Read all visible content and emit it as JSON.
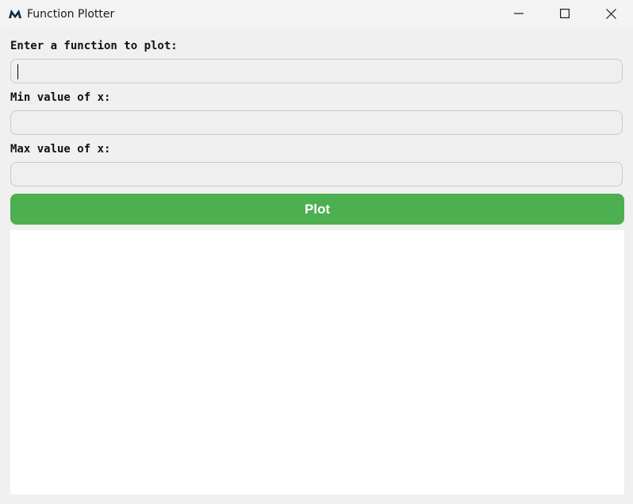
{
  "window": {
    "title": "Function Plotter",
    "logo_icon": "matlab-style-logo-icon"
  },
  "form": {
    "function_label": "Enter a function to plot:",
    "function_value": "",
    "min_label": "Min value of x:",
    "min_value": "",
    "max_label": "Max value of x:",
    "max_value": ""
  },
  "actions": {
    "plot_label": "Plot",
    "plot_color": "#4caf50"
  }
}
